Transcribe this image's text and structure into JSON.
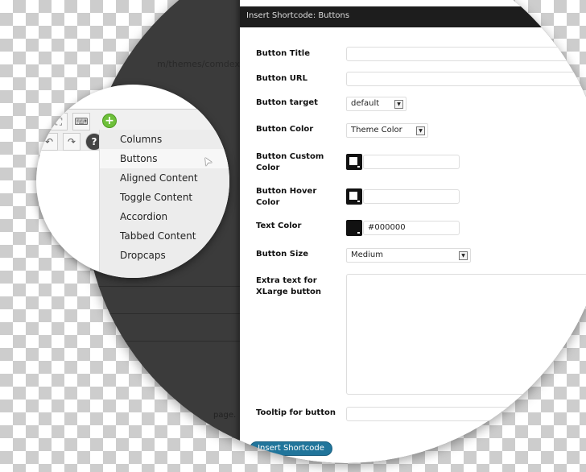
{
  "background": {
    "url_fragment": "m/themes/comdex-w",
    "page_fragment": "page."
  },
  "modal": {
    "title": "Insert Shortcode: Buttons",
    "fields": {
      "button_title": {
        "label": "Button Title",
        "value": ""
      },
      "button_url": {
        "label": "Button URL",
        "value": ""
      },
      "button_target": {
        "label": "Button target",
        "value": "default"
      },
      "button_color": {
        "label": "Button Color",
        "value": "Theme Color"
      },
      "button_custom_color": {
        "label": "Button Custom Color",
        "value": ""
      },
      "button_hover_color": {
        "label": "Button Hover Color",
        "value": ""
      },
      "text_color": {
        "label": "Text Color",
        "value": "#000000"
      },
      "button_size": {
        "label": "Button Size",
        "value": "Medium"
      },
      "extra_text": {
        "label": "Extra text for XLarge button",
        "value": ""
      },
      "tooltip": {
        "label": "Tooltip for button",
        "value": ""
      }
    },
    "submit_label": "Insert Shortcode",
    "accent": "#21759b"
  },
  "shortcode_menu": {
    "items": [
      "Columns",
      "Buttons",
      "Aligned Content",
      "Toggle Content",
      "Accordion",
      "Tabbed Content",
      "Dropcaps"
    ],
    "hovered": "Buttons"
  }
}
